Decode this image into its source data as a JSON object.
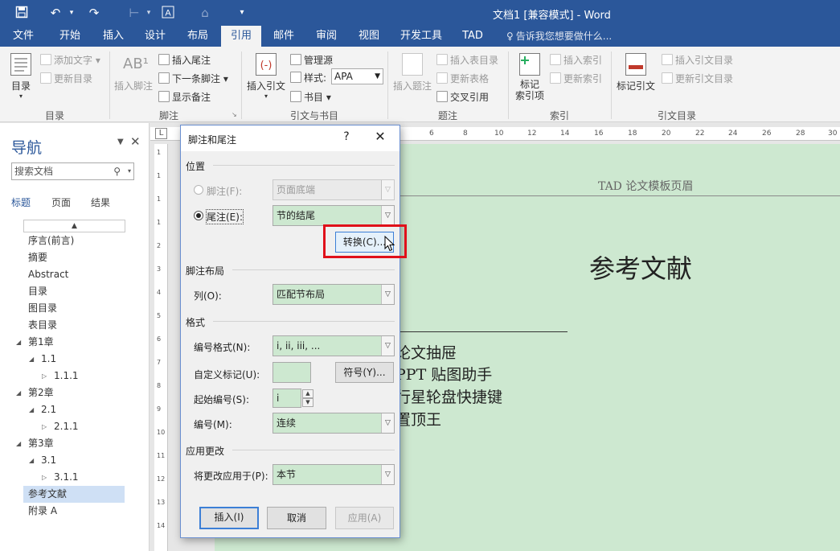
{
  "window": {
    "title": "文档1 [兼容模式] - Word"
  },
  "menu": {
    "tabs": [
      "文件",
      "开始",
      "插入",
      "设计",
      "布局",
      "引用",
      "邮件",
      "审阅",
      "视图",
      "开发工具",
      "TAD"
    ],
    "active": "引用",
    "tell_me": "告诉我您想要做什么..."
  },
  "ribbon": {
    "toc": {
      "button": "目录",
      "add_text": "添加文字",
      "update_toc": "更新目录",
      "group": "目录"
    },
    "footnotes": {
      "insert_footnote": "插入脚注",
      "insert_endnote": "插入尾注",
      "next_footnote": "下一条脚注",
      "show_notes": "显示备注",
      "group": "脚注"
    },
    "citations": {
      "insert_citation": "插入引文",
      "manage_sources": "管理源",
      "style_label": "样式:",
      "style_value": "APA",
      "bibliography": "书目",
      "group": "引文与书目"
    },
    "captions": {
      "insert_caption": "插入题注",
      "insert_table_of_figures": "插入表目录",
      "update_table": "更新表格",
      "cross_reference": "交叉引用",
      "group": "题注"
    },
    "index": {
      "mark_entry_line1": "标记",
      "mark_entry_line2": "索引项",
      "insert_index": "插入索引",
      "update_index": "更新索引",
      "group": "索引"
    },
    "toa": {
      "mark_citation": "标记引文",
      "insert_toa": "插入引文目录",
      "update_toa": "更新引文目录",
      "group": "引文目录"
    }
  },
  "nav": {
    "title": "导航",
    "search_placeholder": "搜索文档",
    "tabs": [
      "标题",
      "页面",
      "结果"
    ],
    "items": [
      {
        "label": "序言(前言)"
      },
      {
        "label": "摘要"
      },
      {
        "label": "Abstract"
      },
      {
        "label": "目录"
      },
      {
        "label": "图目录"
      },
      {
        "label": "表目录"
      },
      {
        "label": "第1章"
      },
      {
        "label": "1.1"
      },
      {
        "label": "1.1.1"
      },
      {
        "label": "第2章"
      },
      {
        "label": "2.1"
      },
      {
        "label": "2.1.1"
      },
      {
        "label": "第3章"
      },
      {
        "label": "3.1"
      },
      {
        "label": "3.1.1"
      },
      {
        "label": "参考文献"
      },
      {
        "label": "附录 A"
      }
    ],
    "selected": "参考文献"
  },
  "ruler": {
    "h_marks": [
      "6",
      "8",
      "10",
      "12",
      "14",
      "16",
      "18",
      "20",
      "22",
      "24",
      "26",
      "28",
      "30"
    ],
    "v_marks": [
      "1",
      "1",
      "1",
      "1",
      "2",
      "3",
      "4",
      "5",
      "6",
      "7",
      "8",
      "9",
      "10",
      "11",
      "12",
      "13",
      "14"
    ]
  },
  "document": {
    "header": "TAD 论文模板页眉",
    "heading": "参考文献",
    "refs": [
      "论文抽屉",
      "PPT 贴图助手",
      "行星轮盘快捷键",
      "置顶王"
    ]
  },
  "dialog": {
    "title": "脚注和尾注",
    "help": "?",
    "position_section": "位置",
    "footnote_label": "脚注(F):",
    "footnote_value": "页面底端",
    "endnote_label": "尾注(E):",
    "endnote_value": "节的结尾",
    "convert_button": "转换(C)...",
    "layout_section": "脚注布局",
    "columns_label": "列(O):",
    "columns_value": "匹配节布局",
    "format_section": "格式",
    "number_format_label": "编号格式(N):",
    "number_format_value": "i, ii, iii, ...",
    "custom_mark_label": "自定义标记(U):",
    "symbol_button": "符号(Y)...",
    "start_at_label": "起始编号(S):",
    "start_at_value": "i",
    "numbering_label": "编号(M):",
    "numbering_value": "连续",
    "apply_section": "应用更改",
    "apply_to_label": "将更改应用于(P):",
    "apply_to_value": "本节",
    "insert_button": "插入(I)",
    "cancel_button": "取消",
    "apply_button": "应用(A)"
  }
}
